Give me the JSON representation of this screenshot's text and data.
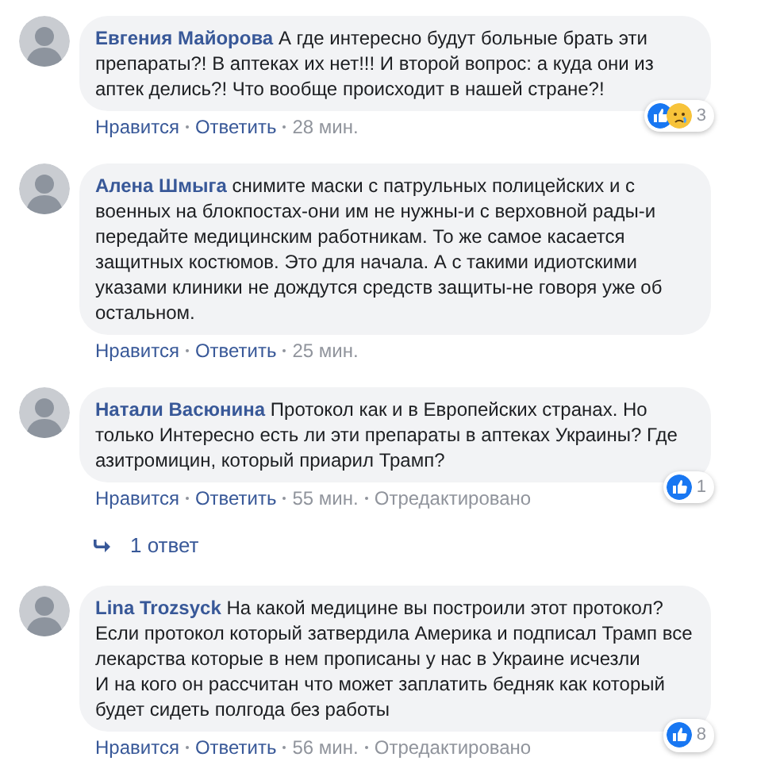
{
  "comments": [
    {
      "author": "Евгения Майорова",
      "text": "А где интересно будут больные брать эти препараты?! В аптеках их нет!!! И второй вопрос: а куда они из аптек делись?! Что вообще происходит в нашей стране?!",
      "actions": [
        "Нравится",
        "Ответить"
      ],
      "time": "28 мин.",
      "reactions": {
        "like": true,
        "sad": true,
        "count": "3"
      }
    },
    {
      "author": "Алена Шмыга",
      "text": "снимите маски с патрульных полицейских и с военных на блокпостах-они им не нужны-и с верховной рады-и передайте медицинским работникам. То же самое касается защитных костюмов. Это для начала. А с такими идиотскими указами клиники не дождутся средств защиты-не говоря уже об остальном.",
      "actions": [
        "Нравится",
        "Ответить"
      ],
      "time": "25 мин."
    },
    {
      "author": "Натали Васюнина",
      "text": "Протокол как и в Европейских странах. Но только Интересно есть ли эти препараты в аптеках Украины? Где азитромицин, который приарил Трамп?",
      "actions": [
        "Нравится",
        "Ответить"
      ],
      "time": "55 мин.",
      "edited": "Отредактировано",
      "reactions": {
        "like": true,
        "sad": false,
        "count": "1"
      },
      "replies": "1 ответ"
    },
    {
      "author": "Lina Trozsyck",
      "text": "На какой медицине вы построили этот протокол?\nЕсли протокол который затвердила Америка и подписал Трамп все лекарства которые в нем прописаны у нас в Украине исчезли\nИ на кого он рассчитан что может заплатить бедняк как который будет сидеть полгода без работы",
      "actions": [
        "Нравится",
        "Ответить"
      ],
      "time": "56 мин.",
      "edited": "Отредактировано",
      "reactions": {
        "like": true,
        "sad": false,
        "count": "8"
      }
    }
  ]
}
